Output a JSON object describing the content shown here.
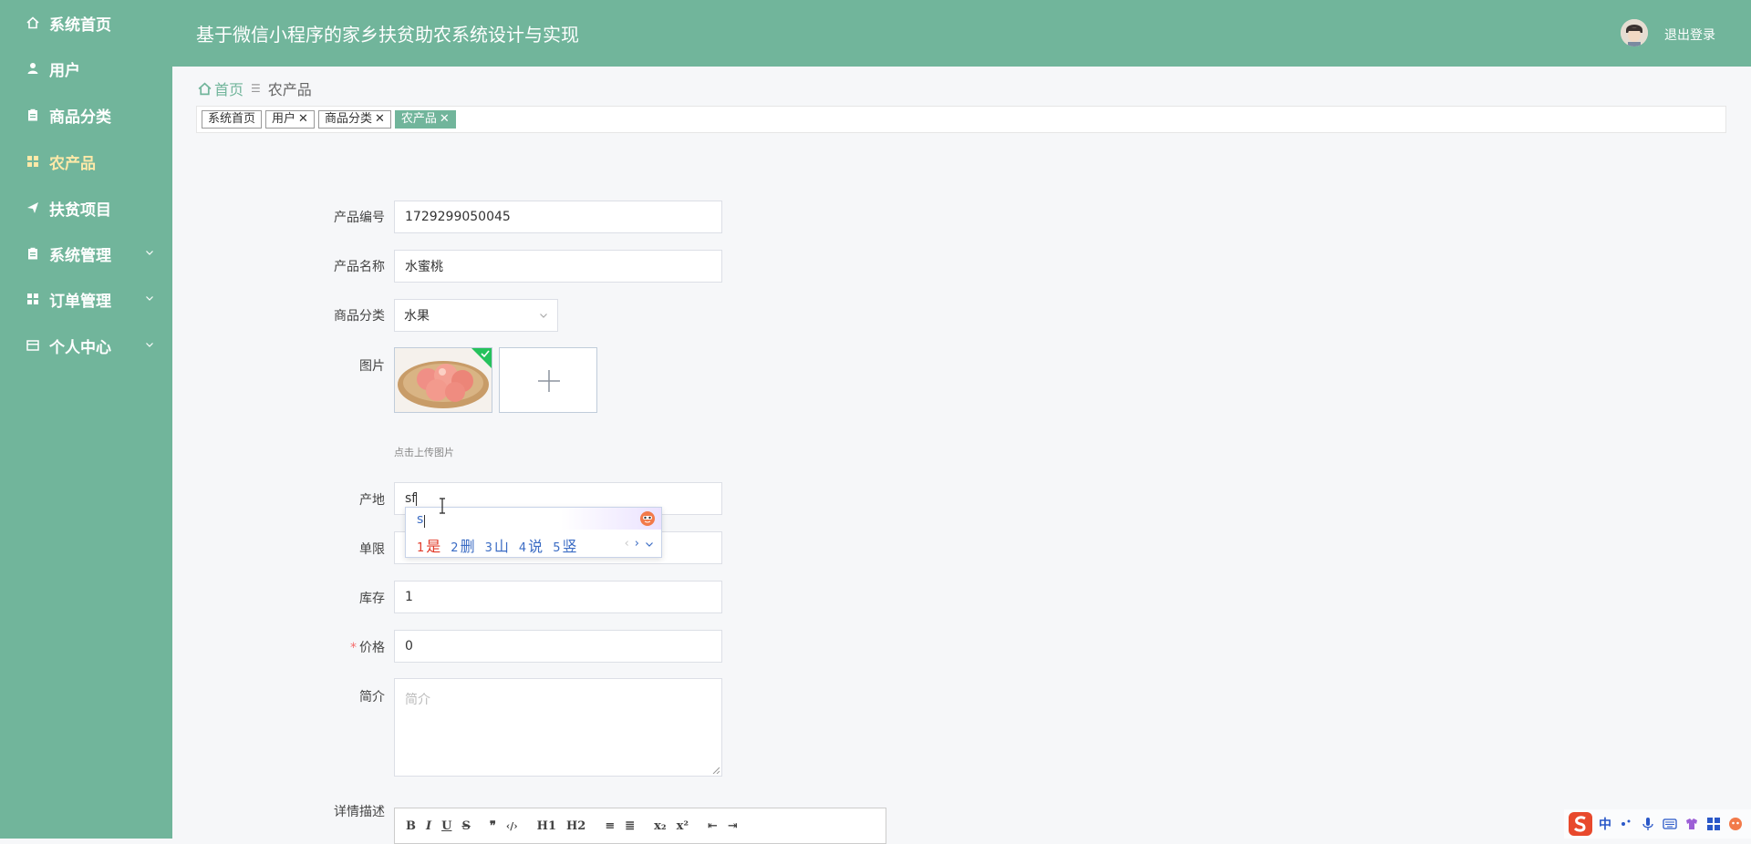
{
  "header": {
    "title": "基于微信小程序的家乡扶贫助农系统设计与实现",
    "logout": "退出登录"
  },
  "sidebar": {
    "items": [
      {
        "label": "系统首页",
        "icon": "home-icon"
      },
      {
        "label": "用户",
        "icon": "user-icon"
      },
      {
        "label": "商品分类",
        "icon": "clipboard-icon"
      },
      {
        "label": "农产品",
        "icon": "grid-icon"
      },
      {
        "label": "扶贫项目",
        "icon": "send-icon"
      },
      {
        "label": "系统管理",
        "icon": "clipboard-icon"
      },
      {
        "label": "订单管理",
        "icon": "grid-icon"
      },
      {
        "label": "个人中心",
        "icon": "card-icon"
      }
    ],
    "active": "农产品"
  },
  "breadcrumb": {
    "home": "首页",
    "current": "农产品"
  },
  "tags": [
    {
      "label": "系统首页",
      "closable": false
    },
    {
      "label": "用户",
      "closable": true
    },
    {
      "label": "商品分类",
      "closable": true
    },
    {
      "label": "农产品",
      "closable": true
    }
  ],
  "form": {
    "product_no": {
      "label": "产品编号",
      "value": "1729299050045"
    },
    "product_name": {
      "label": "产品名称",
      "value": "水蜜桃"
    },
    "category": {
      "label": "商品分类",
      "value": "水果"
    },
    "image": {
      "label": "图片",
      "hint": "点击上传图片"
    },
    "origin": {
      "label": "产地",
      "value": "sf"
    },
    "limit": {
      "label": "单限",
      "value": ""
    },
    "stock": {
      "label": "库存",
      "value": "1"
    },
    "price": {
      "label": "价格",
      "value": "0",
      "required_mark": "*"
    },
    "intro": {
      "label": "简介",
      "placeholder": "简介"
    },
    "detail": {
      "label": "详情描述"
    }
  },
  "editor_toolbar": {
    "buttons": [
      "B",
      "I",
      "U",
      "S",
      "❞",
      "‹/›",
      "H1",
      "H2",
      "≡",
      "≣",
      "x₂",
      "x²",
      "⇤",
      "⇥"
    ]
  },
  "ime": {
    "composition": "s",
    "candidates": [
      {
        "n": "1",
        "text": "是"
      },
      {
        "n": "2",
        "text": "删"
      },
      {
        "n": "3",
        "text": "山"
      },
      {
        "n": "4",
        "text": "说"
      },
      {
        "n": "5",
        "text": "竖"
      }
    ]
  },
  "tray": {
    "lang": "中"
  },
  "colors": {
    "primary": "#71b59b",
    "accent": "#ffe9a8",
    "required": "#f56c6c"
  }
}
